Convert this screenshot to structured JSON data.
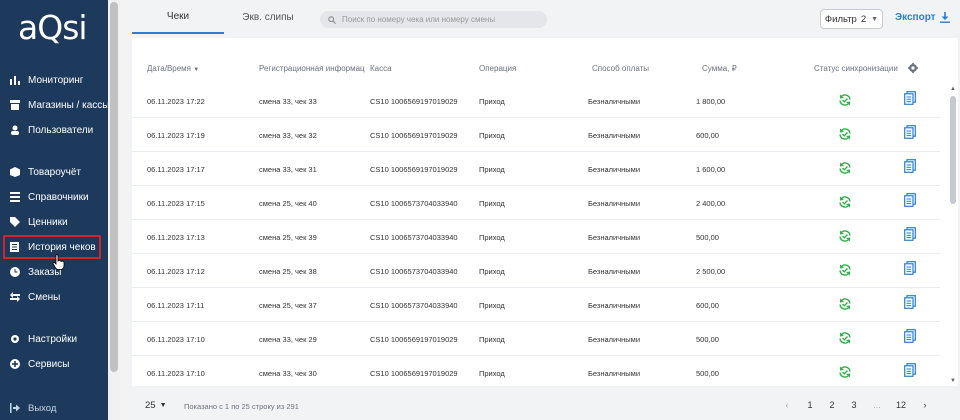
{
  "app": {
    "logo": "aQsi"
  },
  "sidebar": {
    "items": [
      {
        "label": "Мониторинг",
        "icon": "bar-chart-icon"
      },
      {
        "label": "Магазины / кассы",
        "icon": "store-icon"
      },
      {
        "label": "Пользователи",
        "icon": "user-icon"
      },
      {
        "label": "Товароучёт",
        "icon": "box-icon"
      },
      {
        "label": "Справочники",
        "icon": "list-icon"
      },
      {
        "label": "Ценники",
        "icon": "tag-icon"
      },
      {
        "label": "История чеков",
        "icon": "receipt-icon",
        "active": true
      },
      {
        "label": "Заказы",
        "icon": "clock-icon"
      },
      {
        "label": "Смены",
        "icon": "swap-icon"
      },
      {
        "label": "Настройки",
        "icon": "gear-icon"
      },
      {
        "label": "Сервисы",
        "icon": "plus-circle-icon"
      }
    ],
    "logout": "Выход"
  },
  "topbar": {
    "tabs": [
      {
        "label": "Чеки",
        "active": true
      },
      {
        "label": "Экв. слипы",
        "active": false
      }
    ],
    "search_placeholder": "Поиск по номеру чека или номеру смены",
    "filter_label": "Фильтр",
    "filter_count": "2",
    "export_label": "Экспорт"
  },
  "table": {
    "headers": {
      "datetime": "Дата/Время",
      "reg": "Регистрационная информац",
      "kassa": "Касса",
      "operation": "Операция",
      "payment": "Способ оплаты",
      "sum": "Сумма, ₽",
      "sync": "Статус синхронизации"
    },
    "rows": [
      {
        "datetime": "06.11.2023 17:22",
        "reg": "смена 33, чек 33",
        "kassa": "CS10 1006569197019029",
        "operation": "Приход",
        "payment": "Безналичными",
        "sum": "1 800,00"
      },
      {
        "datetime": "06.11.2023 17:19",
        "reg": "смена 33, чек 32",
        "kassa": "CS10 1006569197019029",
        "operation": "Приход",
        "payment": "Безналичными",
        "sum": "600,00"
      },
      {
        "datetime": "06.11.2023 17:17",
        "reg": "смена 33, чек 31",
        "kassa": "CS10 1006569197019029",
        "operation": "Приход",
        "payment": "Безналичными",
        "sum": "1 600,00"
      },
      {
        "datetime": "06.11.2023 17:15",
        "reg": "смена 25, чек 40",
        "kassa": "CS10 1006573704033940",
        "operation": "Приход",
        "payment": "Безналичными",
        "sum": "2 400,00"
      },
      {
        "datetime": "06.11.2023 17:13",
        "reg": "смена 25, чек 39",
        "kassa": "CS10 1006573704033940",
        "operation": "Приход",
        "payment": "Безналичными",
        "sum": "500,00"
      },
      {
        "datetime": "06.11.2023 17:12",
        "reg": "смена 25, чек 38",
        "kassa": "CS10 1006573704033940",
        "operation": "Приход",
        "payment": "Безналичными",
        "sum": "2 500,00"
      },
      {
        "datetime": "06.11.2023 17:11",
        "reg": "смена 25, чек 37",
        "kassa": "CS10 1006573704033940",
        "operation": "Приход",
        "payment": "Безналичными",
        "sum": "600,00"
      },
      {
        "datetime": "06.11.2023 17:10",
        "reg": "смена 33, чек 29",
        "kassa": "CS10 1006569197019029",
        "operation": "Приход",
        "payment": "Безналичными",
        "sum": "500,00"
      },
      {
        "datetime": "06.11.2023 17:10",
        "reg": "смена 33, чек 30",
        "kassa": "CS10 1006569197019029",
        "operation": "Приход",
        "payment": "Безналичными",
        "sum": "500,00"
      }
    ]
  },
  "footer": {
    "page_size": "25",
    "shown_text": "Показано с 1 по 25 строку из 291",
    "pages": [
      "‹",
      "1",
      "2",
      "3",
      "...",
      "12",
      "›"
    ]
  },
  "colors": {
    "sidebar_bg": "#1d3a5c",
    "accent": "#2a7fd4",
    "sync_ok": "#2fb34a",
    "active_outline": "#d0242b"
  }
}
